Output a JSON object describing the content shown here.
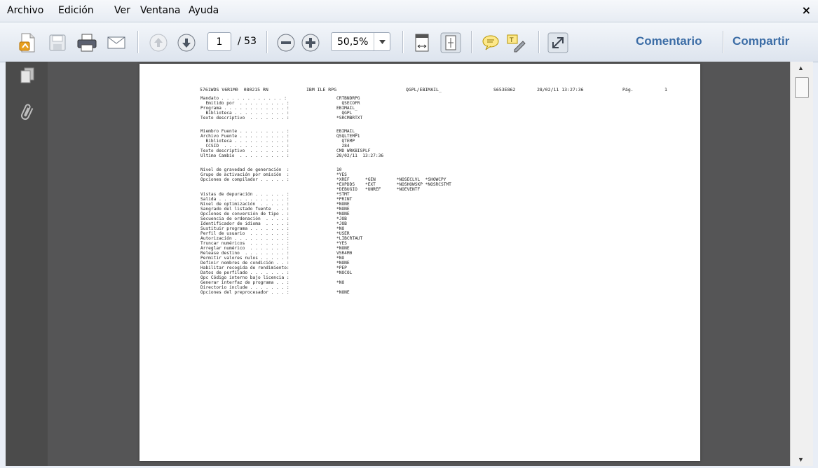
{
  "menu": {
    "archivo": "Archivo",
    "edicion": "Edición",
    "ver": "Ver",
    "ventana": "Ventana",
    "ayuda": "Ayuda",
    "close": "×"
  },
  "toolbar": {
    "page_current": "1",
    "page_total": "/ 53",
    "zoom": "50,5%",
    "comentario": "Comentario",
    "compartir": "Compartir",
    "icons": [
      "create-pdf-icon",
      "save-icon",
      "print-icon",
      "email-icon",
      "previous-page-icon",
      "next-page-icon",
      "zoom-out-icon",
      "zoom-in-icon",
      "fit-width-icon",
      "fit-page-icon",
      "comment-icon",
      "highlight-icon",
      "full-screen-icon"
    ]
  },
  "sidebar": {
    "icons": [
      "pages-icon",
      "attachments-icon"
    ]
  },
  "colors": {
    "doc_background": "#555556",
    "link_blue": "#3c6da6"
  },
  "document": {
    "header": {
      "product": "5761WDS V6R1M0  080215 RN",
      "compiler": "IBM ILE RPG",
      "object": "QGPL/EBIMAIL_",
      "serial": "S653E862",
      "datetime": "28/02/11 13:27:36",
      "page_label": "Pág.",
      "page_number": "1"
    },
    "block1": [
      {
        "label": "Mandato . . . . . . . . . . . . :",
        "value": "CRTBNDRPG"
      },
      {
        "label": "  Emitido por  . . . . . . . . . :",
        "value": "  QSECOFR"
      },
      {
        "label": "Programa . . . . . . . . . . . . :",
        "value": "EBIMAIL_"
      },
      {
        "label": "  Biblioteca . . . . . . . . . . :",
        "value": "  QGPL"
      },
      {
        "label": "Texto descriptivo  . . . . . . . :",
        "value": "*SRCMBRTXT"
      }
    ],
    "block2": [
      {
        "label": "Miembro Fuente . . . . . . . . . :",
        "value": "EBIMAIL_"
      },
      {
        "label": "Archivo Fuente . . . . . . . . . :",
        "value": "QSQLTEMP1"
      },
      {
        "label": "  Biblioteca . . . . . . . . . . :",
        "value": "  QTEMP"
      },
      {
        "label": "  CCSID  . . . . . . . . . . . . :",
        "value": "  284"
      },
      {
        "label": "Texto descriptivo  . . . . . . . :",
        "value": "CMD WRKBISPLF"
      },
      {
        "label": "Ultimo Cambio  . . . . . . . . . :",
        "value": "28/02/11  13:27:36"
      }
    ],
    "block3": [
      {
        "label": "Nivel de gravedad de generación  :",
        "value": "10"
      },
      {
        "label": "Grupo de activación por omisión  :",
        "value": "*YES"
      },
      {
        "label": "Opciones de compilador . . . . . :",
        "value": "*XREF      *GEN        *NOSECLVL  *SHOWCPY"
      },
      {
        "label": "",
        "value": "*EXPDDS    *EXT        *NOSHOWSKP *NOSRCSTMT"
      },
      {
        "label": "",
        "value": "*DEBUGIO   *UNREF      *NOEVENTF"
      },
      {
        "label": "Vistas de depuración . . . . . . :",
        "value": "*STMT"
      },
      {
        "label": "Salida . . . . . . . . . . . . . :",
        "value": "*PRINT"
      },
      {
        "label": "Nivel de optimización  . . . . . :",
        "value": "*NONE"
      },
      {
        "label": "Sangrado del listado fuente  . . :",
        "value": "*NONE"
      },
      {
        "label": "Opciones de conversión de tipo . :",
        "value": "*NONE"
      },
      {
        "label": "Secuencia de ordenación  . . . . :",
        "value": "*JOB"
      },
      {
        "label": "Identificador de idioma  . . . . :",
        "value": "*JOB"
      },
      {
        "label": "Sustituir programa . . . . . . . :",
        "value": "*NO"
      },
      {
        "label": "Perfil de usuario  . . . . . . . :",
        "value": "*USER"
      },
      {
        "label": "Autorización . . . . . . . . . . :",
        "value": "*LIBCRTAUT"
      },
      {
        "label": "Truncar numéricos  . . . . . . . :",
        "value": "*YES"
      },
      {
        "label": "Arreglar numérico  . . . . . . . :",
        "value": "*NONE"
      },
      {
        "label": "Release destino  . . . . . . . . :",
        "value": "V5R4M0"
      },
      {
        "label": "Permitir valores nulos . . . . . :",
        "value": "*NO"
      },
      {
        "label": "Definir nombres de condición . . :",
        "value": "*NONE"
      },
      {
        "label": "Habilitar recogida de rendimiento:",
        "value": "*PEP"
      },
      {
        "label": "Datos de perfilado . . . . . . . :",
        "value": "*NOCOL"
      },
      {
        "label": "Opc Código interno bajo licencia :",
        "value": ""
      },
      {
        "label": "Generar interfaz de programa . . :",
        "value": "*NO"
      },
      {
        "label": "Directorio include . . . . . . . :",
        "value": ""
      },
      {
        "label": "Opciones del preprocesador . . . :",
        "value": "*NONE"
      }
    ]
  }
}
